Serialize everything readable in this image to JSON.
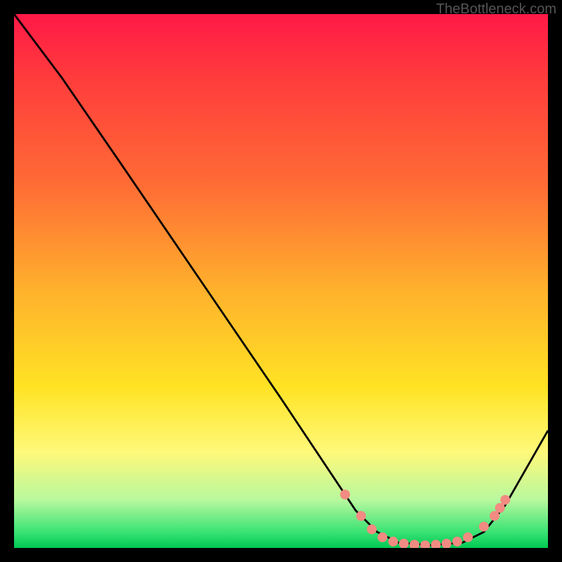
{
  "watermark": "TheBottleneck.com",
  "chart_data": {
    "type": "line",
    "title": "",
    "xlabel": "",
    "ylabel": "",
    "xlim": [
      0,
      100
    ],
    "ylim": [
      0,
      100
    ],
    "background_gradient": {
      "direction": "vertical",
      "stops": [
        {
          "pct": 0,
          "color": "#ff1947"
        },
        {
          "pct": 12,
          "color": "#ff3c3c"
        },
        {
          "pct": 32,
          "color": "#ff6c35"
        },
        {
          "pct": 52,
          "color": "#ffb22c"
        },
        {
          "pct": 70,
          "color": "#ffe324"
        },
        {
          "pct": 82,
          "color": "#fff97a"
        },
        {
          "pct": 91,
          "color": "#b8f89e"
        },
        {
          "pct": 97,
          "color": "#3ae374"
        },
        {
          "pct": 100,
          "color": "#00c853"
        }
      ]
    },
    "series": [
      {
        "name": "bottleneck-curve",
        "color": "#000000",
        "width": 2,
        "points": [
          {
            "x": 0,
            "y": 100
          },
          {
            "x": 6,
            "y": 92
          },
          {
            "x": 9,
            "y": 88
          },
          {
            "x": 20,
            "y": 72
          },
          {
            "x": 35,
            "y": 50
          },
          {
            "x": 50,
            "y": 28
          },
          {
            "x": 60,
            "y": 13
          },
          {
            "x": 64,
            "y": 7
          },
          {
            "x": 68,
            "y": 3
          },
          {
            "x": 72,
            "y": 1
          },
          {
            "x": 78,
            "y": 0.5
          },
          {
            "x": 84,
            "y": 1
          },
          {
            "x": 88,
            "y": 3
          },
          {
            "x": 92,
            "y": 8
          },
          {
            "x": 100,
            "y": 22
          }
        ]
      }
    ],
    "markers": {
      "name": "optimal-range-dots",
      "color": "#f28b82",
      "radius": 7,
      "points": [
        {
          "x": 62,
          "y": 10
        },
        {
          "x": 65,
          "y": 6
        },
        {
          "x": 67,
          "y": 3.5
        },
        {
          "x": 69,
          "y": 2
        },
        {
          "x": 71,
          "y": 1.2
        },
        {
          "x": 73,
          "y": 0.8
        },
        {
          "x": 75,
          "y": 0.6
        },
        {
          "x": 77,
          "y": 0.5
        },
        {
          "x": 79,
          "y": 0.6
        },
        {
          "x": 81,
          "y": 0.8
        },
        {
          "x": 83,
          "y": 1.2
        },
        {
          "x": 85,
          "y": 2
        },
        {
          "x": 88,
          "y": 4
        },
        {
          "x": 90,
          "y": 6
        },
        {
          "x": 91,
          "y": 7.5
        },
        {
          "x": 92,
          "y": 9
        }
      ]
    }
  }
}
